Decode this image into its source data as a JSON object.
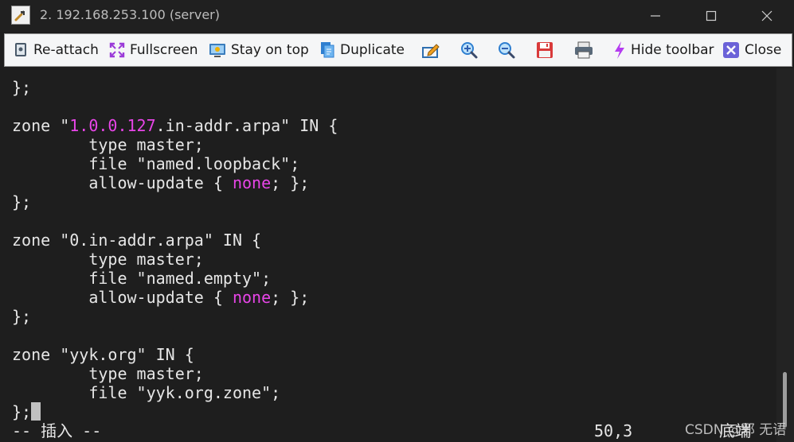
{
  "window": {
    "title": "2. 192.168.253.100 (server)"
  },
  "toolbar": {
    "reattach_label": "Re-attach",
    "fullscreen_label": "Fullscreen",
    "stay_on_top_label": "Stay on top",
    "duplicate_label": "Duplicate",
    "hide_toolbar_label": "Hide toolbar",
    "close_label": "Close"
  },
  "terminal": {
    "lines": [
      {
        "plain": "};"
      },
      {
        "plain": ""
      },
      {
        "pre": "zone \"",
        "hl": "1.0.0.127",
        "post": ".in-addr.arpa\" IN {"
      },
      {
        "plain": "        type master;"
      },
      {
        "plain": "        file \"named.loopback\";"
      },
      {
        "pre": "        allow-update { ",
        "hl": "none",
        "post": "; };"
      },
      {
        "plain": "};"
      },
      {
        "plain": ""
      },
      {
        "plain": "zone \"0.in-addr.arpa\" IN {"
      },
      {
        "plain": "        type master;"
      },
      {
        "plain": "        file \"named.empty\";"
      },
      {
        "pre": "        allow-update { ",
        "hl": "none",
        "post": "; };"
      },
      {
        "plain": "};"
      },
      {
        "plain": ""
      },
      {
        "plain": "zone \"yyk.org\" IN {"
      },
      {
        "plain": "        type master;"
      },
      {
        "plain": "        file \"yyk.org.zone\";"
      },
      {
        "plain": "};"
      }
    ],
    "status_mode": "-- 插入 --",
    "status_position": "50,3",
    "status_bottom": "底端"
  },
  "colors": {
    "background": "#1e1e1e",
    "text": "#e6e6e6",
    "highlight": "#e845e8",
    "toolbar_bg": "#f5f6f7"
  },
  "icons": {
    "reattach": "monitor-pin-icon",
    "fullscreen": "expand-arrows-icon",
    "stay_on_top": "window-pin-icon",
    "duplicate": "duplicate-pages-icon",
    "edit": "pencil-edit-icon",
    "zoom_in": "zoom-in-icon",
    "zoom_out": "zoom-out-icon",
    "save": "floppy-save-icon",
    "print": "printer-icon",
    "hide_toolbar": "lightning-icon",
    "close": "close-x-icon"
  },
  "watermark": {
    "text": "CSDN @邪 无语"
  }
}
